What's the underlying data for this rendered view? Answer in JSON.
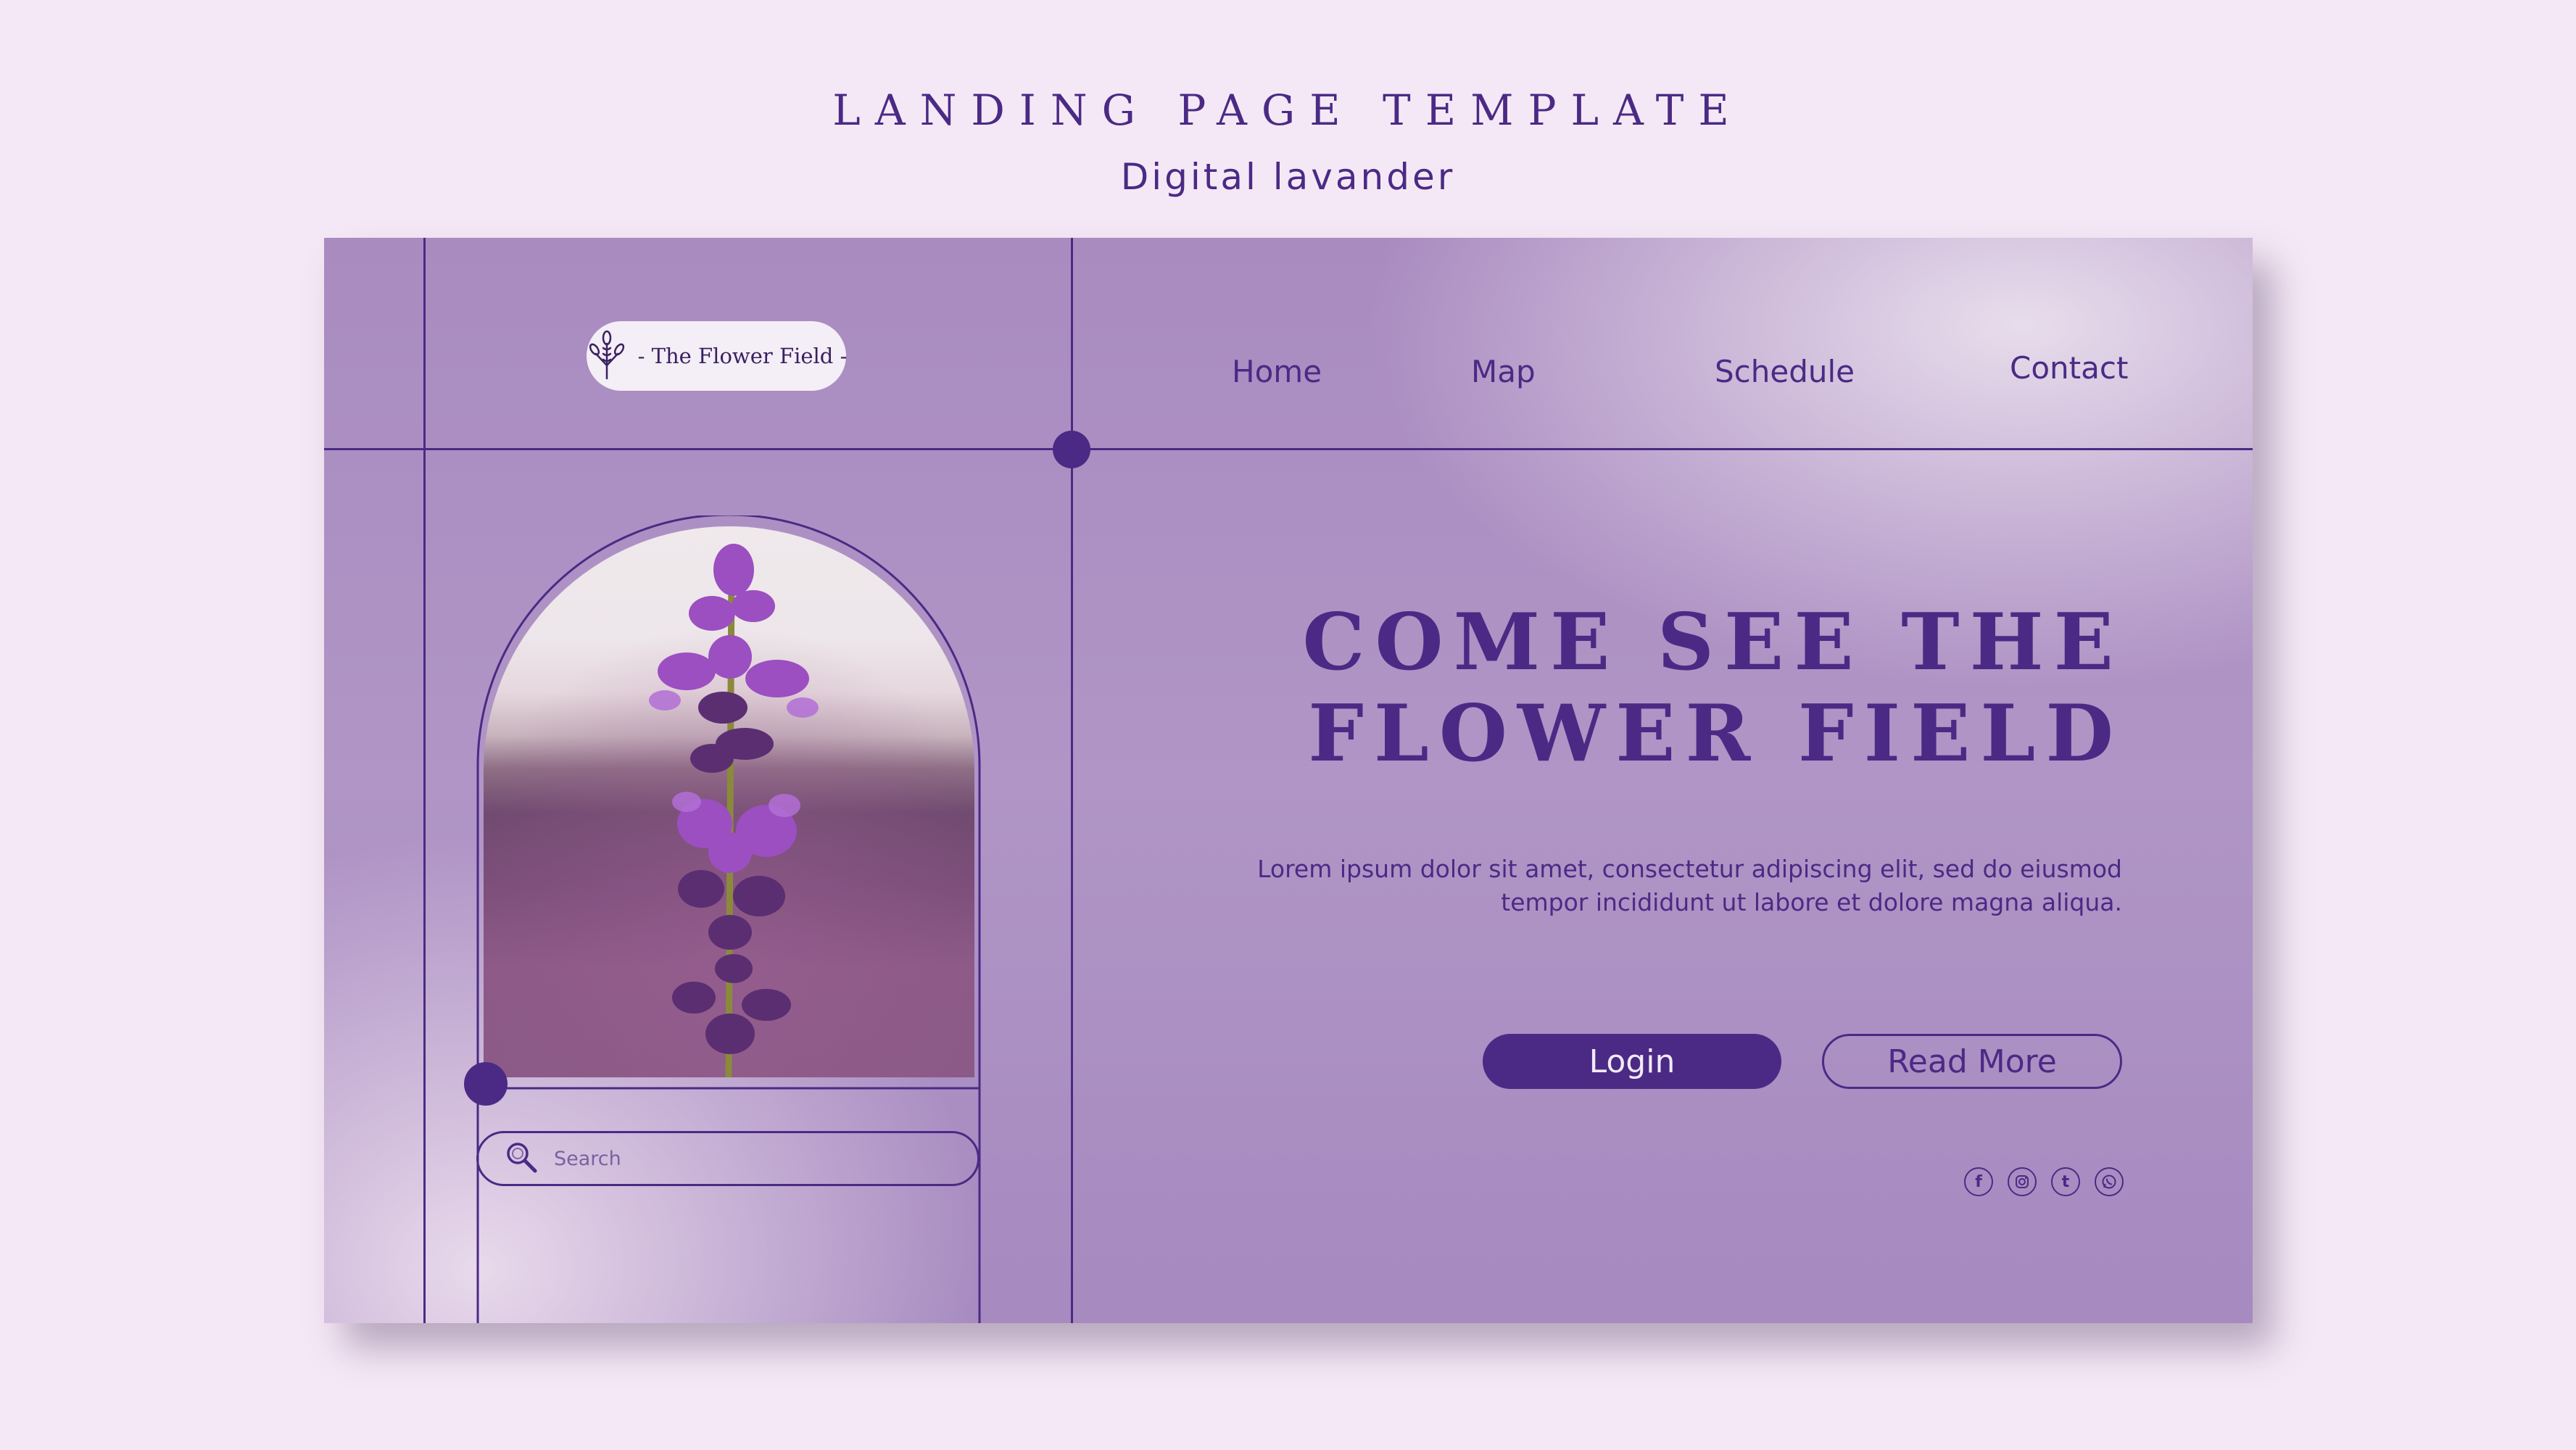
{
  "header": {
    "title": "LANDING PAGE TEMPLATE",
    "subtitle": "Digital lavander"
  },
  "logo": {
    "text": "- The Flower Field -",
    "icon": "lavender-sprig-icon"
  },
  "nav": {
    "items": [
      {
        "label": "Home"
      },
      {
        "label": "Map"
      },
      {
        "label": "Schedule"
      },
      {
        "label": "Contact"
      }
    ]
  },
  "hero": {
    "title_line1": "COME SEE THE",
    "title_line2": "FLOWER FIELD",
    "body_line1": "Lorem ipsum dolor sit amet, consectetur adipiscing elit, sed do eiusmod",
    "body_line2": "tempor incididunt ut labore et dolore magna aliqua.",
    "image": "lavender-flower-photo"
  },
  "search": {
    "placeholder": "Search",
    "icon": "search-icon"
  },
  "buttons": {
    "login": "Login",
    "read_more": "Read More"
  },
  "social": [
    "facebook-icon",
    "instagram-icon",
    "tumblr-icon",
    "whatsapp-icon"
  ],
  "colors": {
    "accent": "#4b2a85",
    "page_background": "#f5e8f6",
    "panel_background": "#a98bc0",
    "pill_background": "#f4eef6"
  }
}
